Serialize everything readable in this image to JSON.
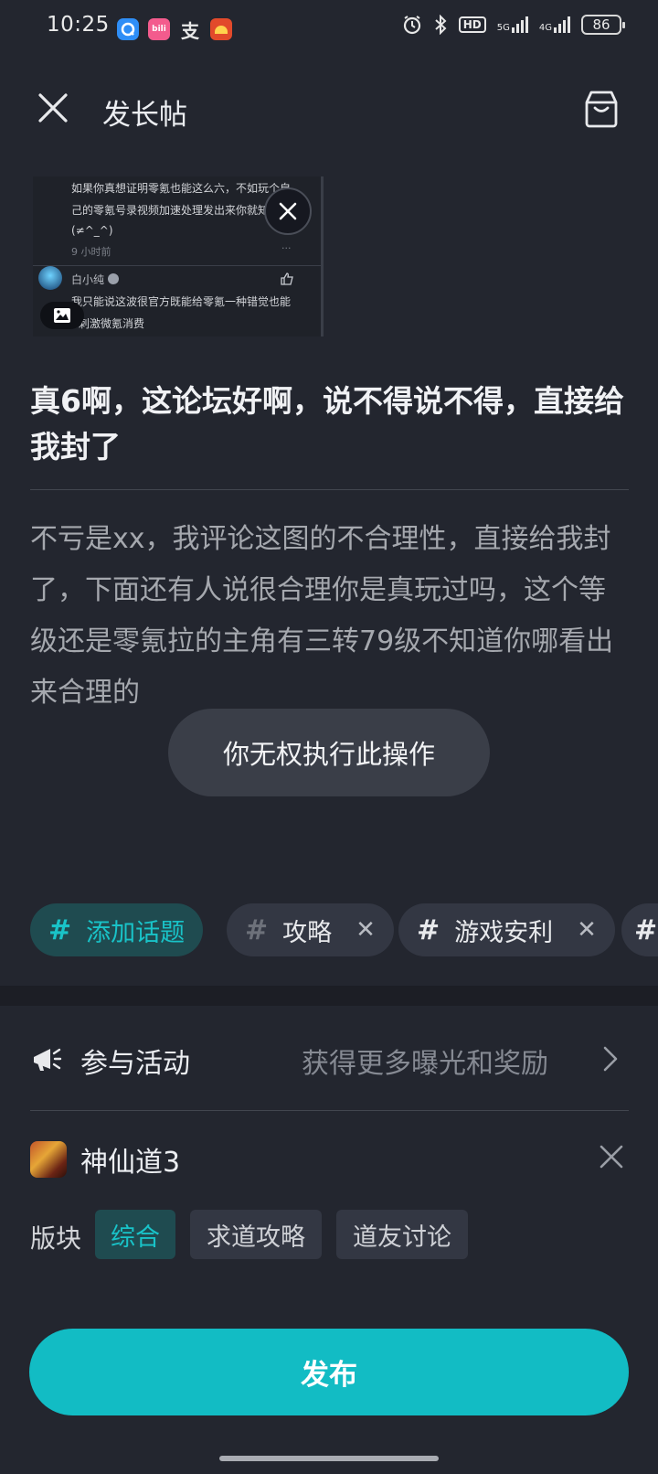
{
  "status_bar": {
    "time": "10:25",
    "app_icons": [
      {
        "name": "q-app-icon",
        "color": "#2f8ef6",
        "glyph": "Q"
      },
      {
        "name": "bilibili-icon",
        "color": "#f35b8d",
        "glyph": "bili"
      },
      {
        "name": "alipay-icon",
        "color": "#23262f",
        "glyph": "支"
      },
      {
        "name": "food-app-icon",
        "color": "#e24a2b",
        "glyph": "●"
      }
    ],
    "network_5g": "5G",
    "network_4g": "4G",
    "hd_label": "HD",
    "battery": "86"
  },
  "header": {
    "title": "发长帖"
  },
  "thumbnail": {
    "line1": "如果你真想证明零氪也能这么六，不如玩个自",
    "line2": "己的零氪号录视频加速处理发出来你就知道了",
    "line3": "(≠^_^)",
    "time_ago": "9 小时前",
    "more": "···",
    "user": "白小纯",
    "reply_line1": "我只能说这波很官方既能给零氪一种错觉也能",
    "reply_line2": "刺激微氪消费"
  },
  "post": {
    "title": "真6啊，这论坛好啊，说不得说不得，直接给我封了",
    "body": "不亏是xx，我评论这图的不合理性，直接给我封了，下面还有人说很合理你是真玩过吗，这个等级还是零氪拉的主角有三转79级不知道你哪看出来合理的"
  },
  "toast": {
    "message": "你无权执行此操作"
  },
  "tags": {
    "add_label": "添加话题",
    "items": [
      "攻略",
      "游戏安利"
    ]
  },
  "activity": {
    "label": "参与活动",
    "hint": "获得更多曝光和奖励"
  },
  "game": {
    "name": "神仙道3"
  },
  "sections": {
    "label": "版块",
    "chips": [
      "综合",
      "求道攻略",
      "道友讨论"
    ]
  },
  "publish": {
    "label": "发布"
  },
  "colors": {
    "background": "#23262f",
    "accent": "#12bcc4",
    "accent_dark": "#1f4b50",
    "toast": "#3a3e48"
  }
}
